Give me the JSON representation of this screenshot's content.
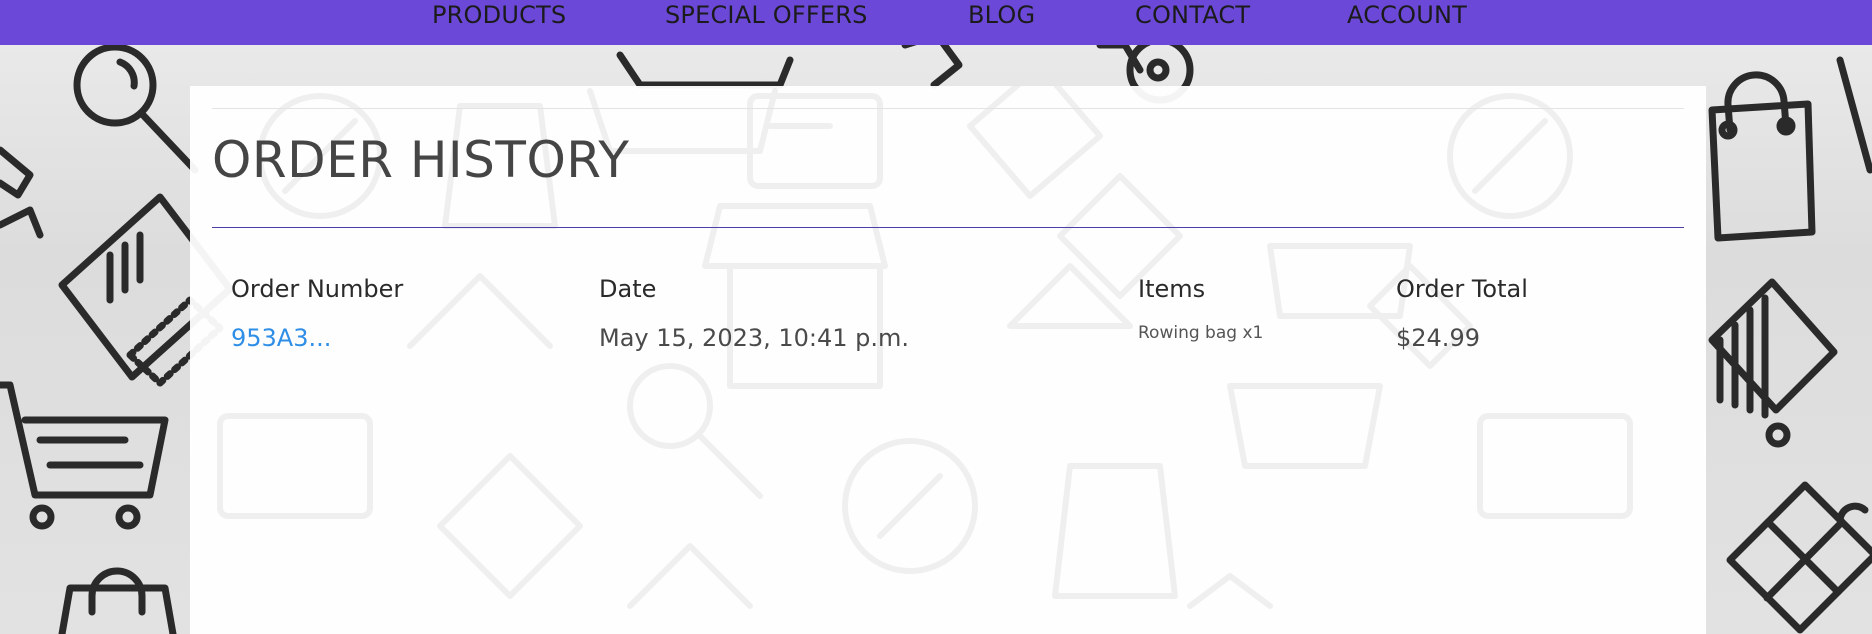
{
  "nav": {
    "items": [
      {
        "label": "PRODUCTS"
      },
      {
        "label": "SPECIAL OFFERS"
      },
      {
        "label": "BLOG"
      },
      {
        "label": "CONTACT"
      },
      {
        "label": "ACCOUNT"
      }
    ]
  },
  "page": {
    "title": "ORDER HISTORY"
  },
  "table": {
    "headers": {
      "order_number": "Order Number",
      "date": "Date",
      "items": "Items",
      "total": "Order Total"
    },
    "rows": [
      {
        "order_number": "953A3...",
        "date": "May 15, 2023, 10:41 p.m.",
        "items": "Rowing bag x1",
        "total": "$24.99"
      }
    ]
  },
  "colors": {
    "nav_background": "#6b48d8",
    "title_rule": "#4a3fa6",
    "link": "#2f8ee6"
  }
}
